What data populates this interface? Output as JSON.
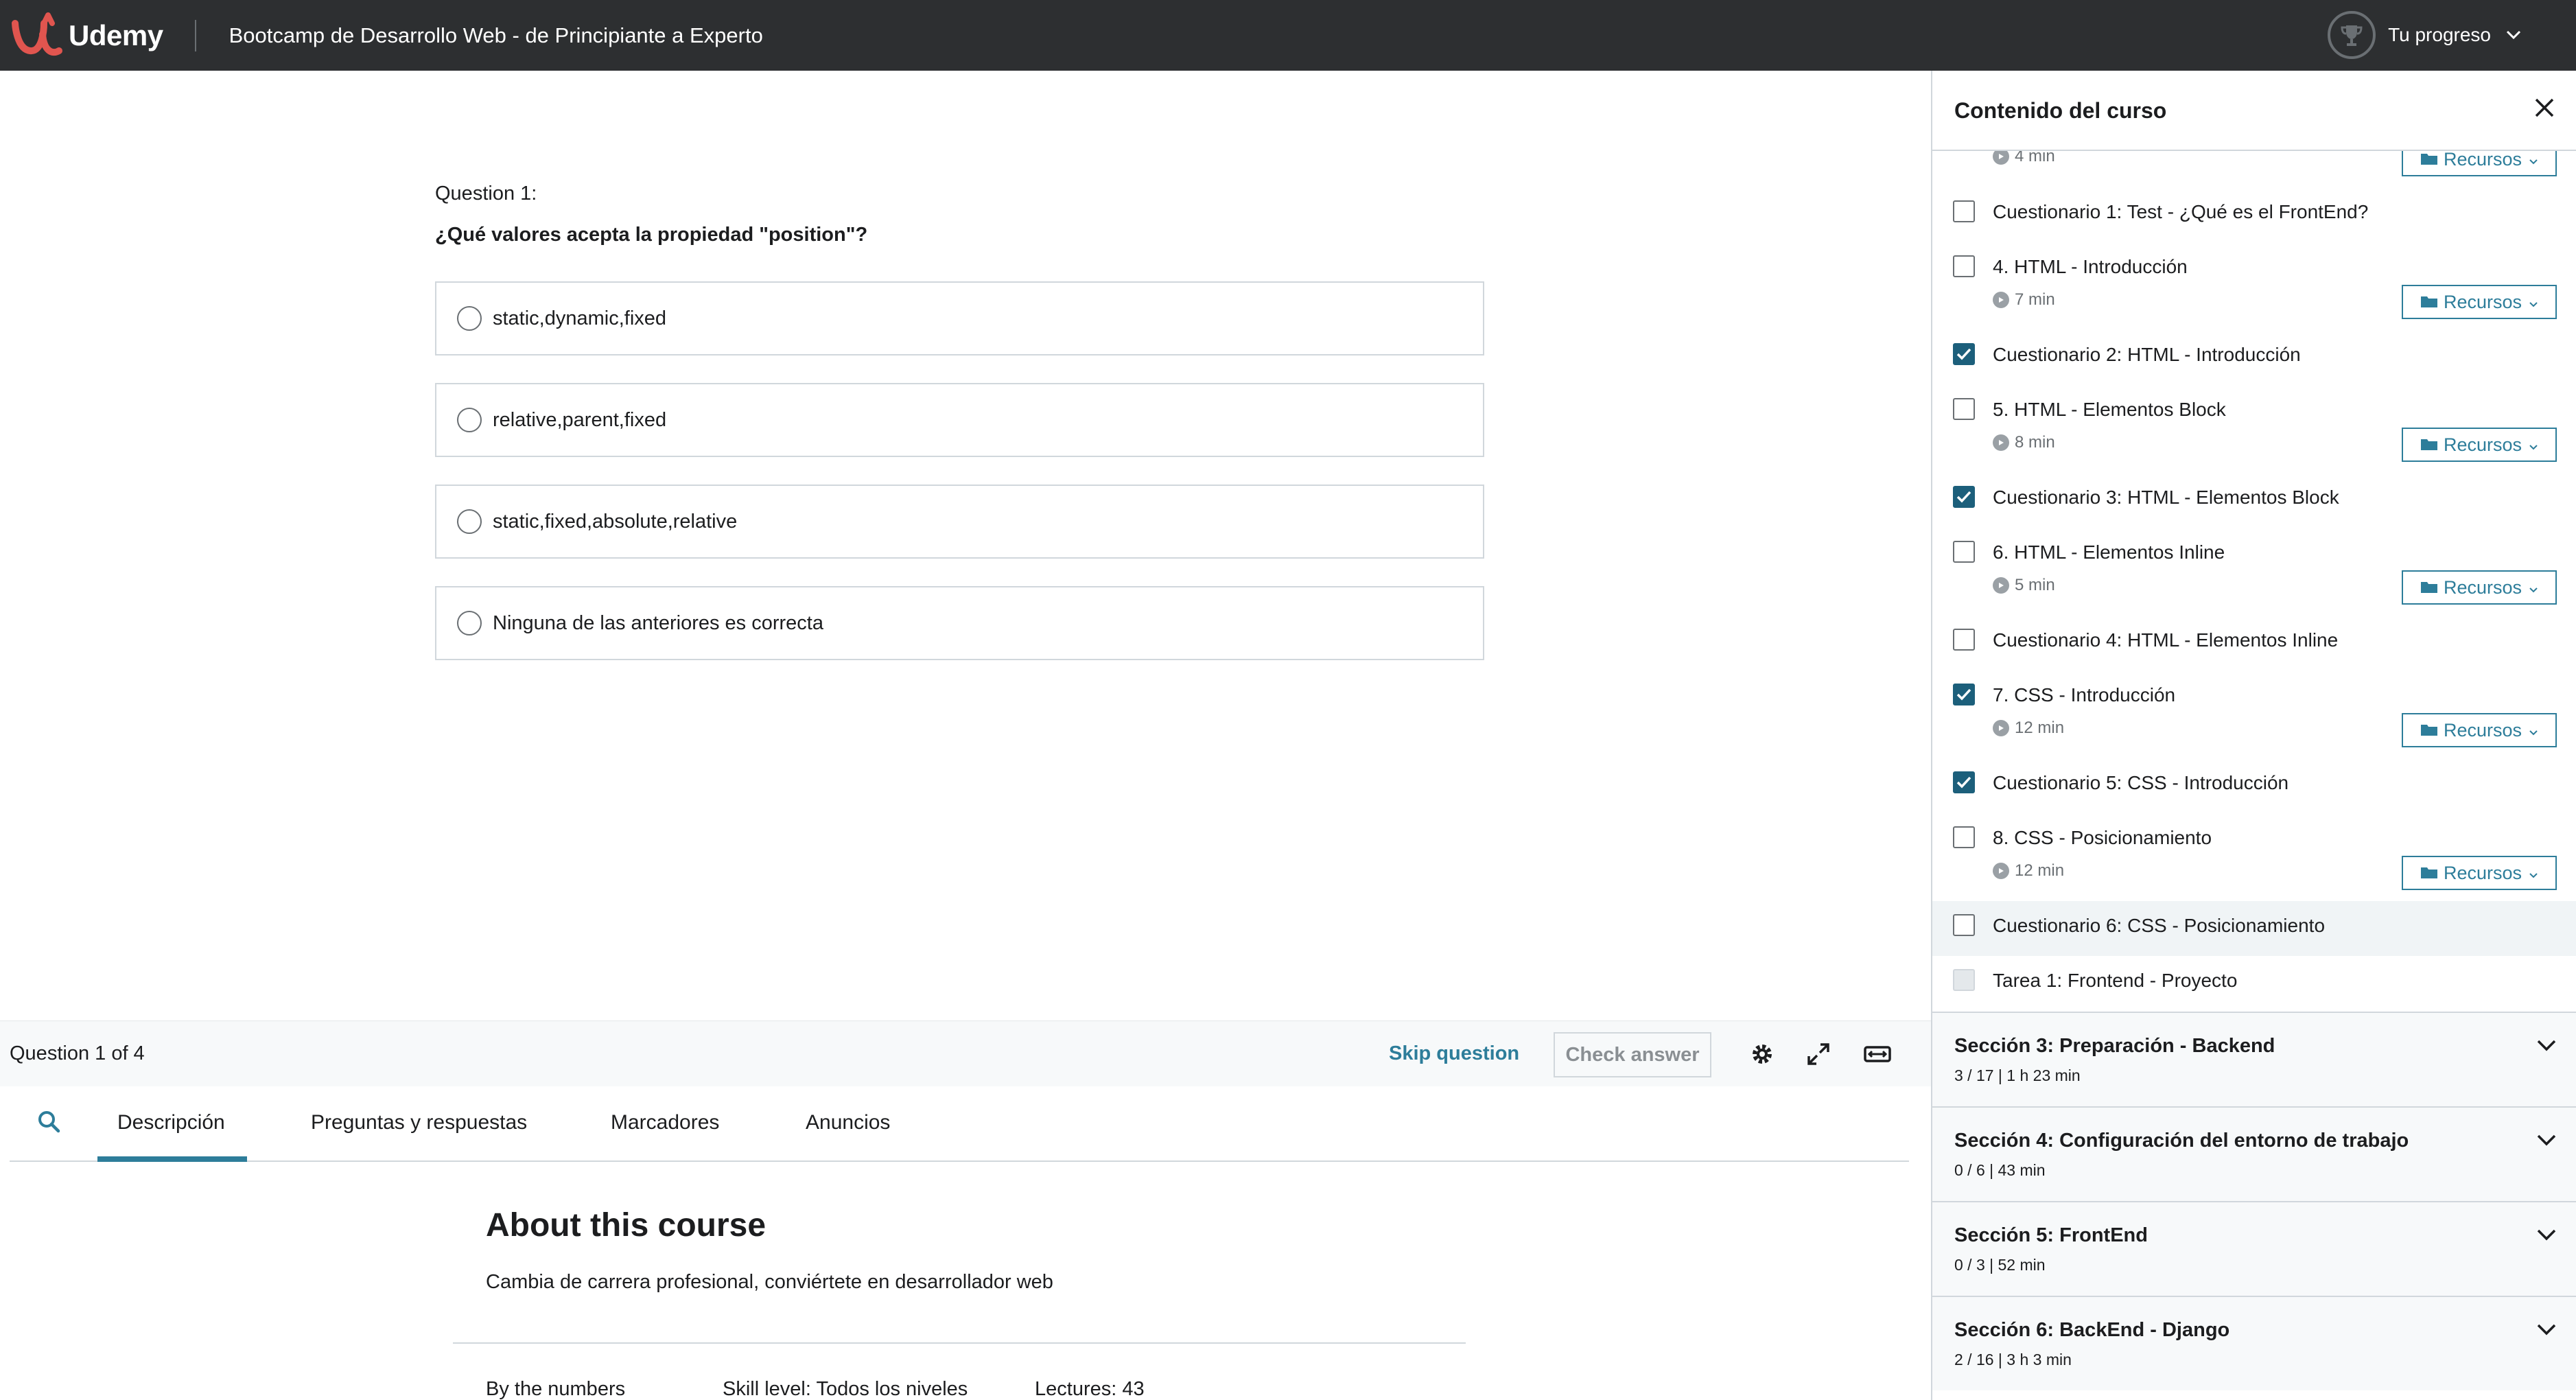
{
  "header": {
    "logo_text": "Udemy",
    "course_title": "Bootcamp de Desarrollo Web - de Principiante a Experto",
    "progress_label": "Tu progreso"
  },
  "quiz": {
    "question_number": "Question 1:",
    "question_text": "¿Qué valores acepta la propiedad \"position\"?",
    "answers": [
      "static,dynamic,fixed",
      "relative,parent,fixed",
      "static,fixed,absolute,relative",
      "Ninguna de las anteriores es correcta"
    ]
  },
  "quiz_bar": {
    "count": "Question 1 of 4",
    "skip_label": "Skip question",
    "check_label": "Check answer"
  },
  "tabs": {
    "items": [
      "Descripción",
      "Preguntas y respuestas",
      "Marcadores",
      "Anuncios"
    ]
  },
  "about": {
    "title": "About this course",
    "description": "Cambia de carrera profesional, conviértete en desarrollador web",
    "by_numbers": "By the numbers",
    "skill_level": "Skill level: Todos los niveles",
    "lectures": "Lectures: 43"
  },
  "sidebar": {
    "title": "Contenido del curso",
    "recursos_label": "Recursos",
    "items": [
      {
        "title": "",
        "duration": "4 min",
        "checked": false
      },
      {
        "title": "Cuestionario 1: Test - ¿Qué es el FrontEnd?",
        "checked": false
      },
      {
        "title": "4. HTML - Introducción",
        "duration": "7 min",
        "checked": false
      },
      {
        "title": "Cuestionario 2: HTML - Introducción",
        "checked": true
      },
      {
        "title": "5. HTML - Elementos Block",
        "duration": "8 min",
        "checked": false
      },
      {
        "title": "Cuestionario 3: HTML - Elementos Block",
        "checked": true
      },
      {
        "title": "6. HTML - Elementos Inline",
        "duration": "5 min",
        "checked": false
      },
      {
        "title": "Cuestionario 4: HTML - Elementos Inline",
        "checked": false
      },
      {
        "title": "7. CSS - Introducción",
        "duration": "12 min",
        "checked": true
      },
      {
        "title": "Cuestionario 5: CSS - Introducción",
        "checked": true
      },
      {
        "title": "8. CSS - Posicionamiento",
        "duration": "12 min",
        "checked": false
      },
      {
        "title": "Cuestionario 6: CSS - Posicionamiento",
        "checked": false
      },
      {
        "title": "Tarea 1: Frontend - Proyecto",
        "checked": false
      }
    ],
    "sections": [
      {
        "title": "Sección 3: Preparación - Backend",
        "meta": "3 / 17 | 1 h 23 min"
      },
      {
        "title": "Sección 4: Configuración del entorno de trabajo",
        "meta": "0 / 6 | 43 min"
      },
      {
        "title": "Sección 5: FrontEnd",
        "meta": "0 / 3 | 52 min"
      },
      {
        "title": "Sección 6: BackEnd - Django",
        "meta": "2 / 16 | 3 h 3 min"
      }
    ]
  },
  "colors": {
    "header_bg": "#2d2f31",
    "accent": "#2d7d9a",
    "checkbox_checked": "#1c5f7b",
    "logo": "#a435f0"
  }
}
